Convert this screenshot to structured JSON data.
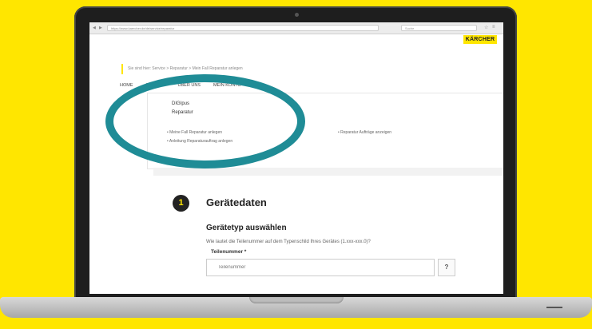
{
  "colors": {
    "background": "#ffe600",
    "brand": "#ffe600",
    "ring": "#1f8c96"
  },
  "browser": {
    "back_icon": "back-icon",
    "forward_icon": "forward-icon",
    "url": "https://www.kaercher.de/de/service/reparatur",
    "search_placeholder": "Suche"
  },
  "header": {
    "logo": "KÄRCHER"
  },
  "notice": {
    "text": "Sie sind hier: Service > Reparatur > Mein Fall Reparatur anlegen"
  },
  "nav": {
    "items": [
      "Home",
      "Service",
      "Über uns",
      "Mein Konto"
    ]
  },
  "dropdown": {
    "title": "DIGIpus",
    "subtitle": "Reparatur",
    "links": [
      "Meine Fall Reparatur anlegen",
      "Anleitung Reparaturauftrag anlegen",
      "Reparatur Aufträge anzeigen"
    ]
  },
  "form": {
    "step": "1",
    "section_title": "Gerätedaten",
    "sub_title": "Gerätetyp auswählen",
    "question": "Wie lautet die Teilenummer auf dem Typenschild Ihres Gerätes (1.xxx-xxx.0)?",
    "field_label": "Teilenummer *",
    "field_placeholder": "Teilenummer",
    "help_label": "?"
  }
}
